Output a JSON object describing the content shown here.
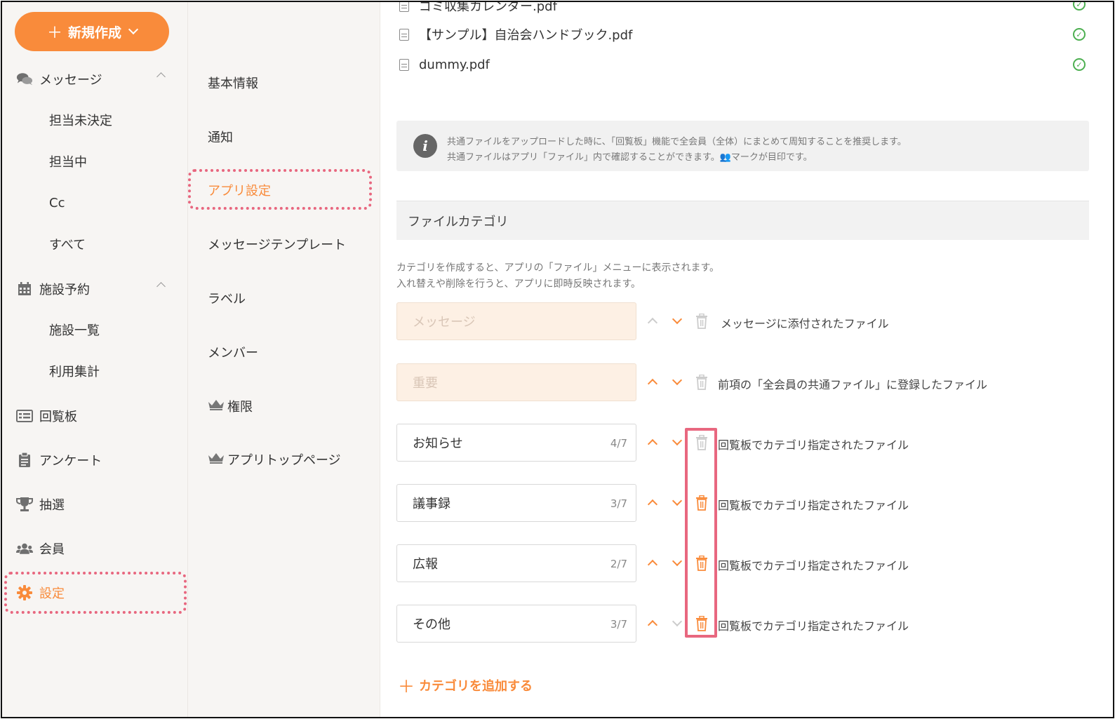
{
  "leftnav": {
    "new_button": "新規作成",
    "messages": "メッセージ",
    "messages_sub": [
      "担当未決定",
      "担当中",
      "Cc",
      "すべて"
    ],
    "facility": "施設予約",
    "facility_sub": [
      "施設一覧",
      "利用集計"
    ],
    "circular": "回覧板",
    "survey": "アンケート",
    "lottery": "抽選",
    "members": "会員",
    "settings": "設定"
  },
  "secnav": {
    "items": [
      "基本情報",
      "通知",
      "アプリ設定",
      "メッセージテンプレート",
      "ラベル",
      "メンバー",
      "権限",
      "アプリトップページ"
    ]
  },
  "files": [
    "ゴミ収集カレンダー.pdf",
    "【サンプル】自治会ハンドブック.pdf",
    "dummy.pdf"
  ],
  "info": {
    "line1": "共通ファイルをアップロードした時に、「回覧板」機能で全会員（全体）にまとめて周知することを推奨します。",
    "line2": "共通ファイルはアプリ「ファイル」内で確認することができます。👥マークが目印です。"
  },
  "category": {
    "title": "ファイルカテゴリ",
    "desc1": "カテゴリを作成すると、アプリの「ファイル」メニューに表示されます。",
    "desc2": "入れ替えや削除を行うと、アプリに即時反映されます。",
    "rows": [
      {
        "name": "メッセージ",
        "count": "",
        "note": "メッセージに添付されたファイル"
      },
      {
        "name": "重要",
        "count": "",
        "note": "前項の「全会員の共通ファイル」に登録したファイル"
      },
      {
        "name": "お知らせ",
        "count": "4/7",
        "note": "回覧板でカテゴリ指定されたファイル"
      },
      {
        "name": "議事録",
        "count": "3/7",
        "note": "回覧板でカテゴリ指定されたファイル"
      },
      {
        "name": "広報",
        "count": "2/7",
        "note": "回覧板でカテゴリ指定されたファイル"
      },
      {
        "name": "その他",
        "count": "3/7",
        "note": "回覧板でカテゴリ指定されたファイル"
      }
    ],
    "add_label": "カテゴリを追加する"
  },
  "colors": {
    "accent": "#f98b3b",
    "highlight": "#e8677f"
  }
}
